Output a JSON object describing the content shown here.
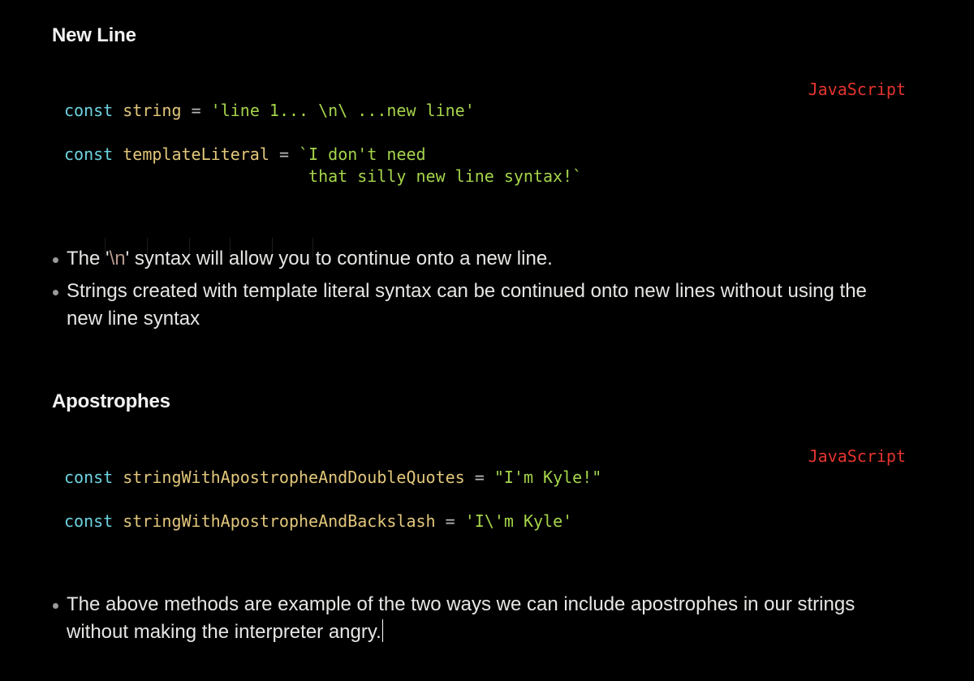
{
  "sections": [
    {
      "heading": "New Line",
      "language": "JavaScript",
      "code": {
        "line1": {
          "keyword": "const",
          "name": "string",
          "op": "=",
          "value": "'line 1... \\n\\ ...new line'"
        },
        "line2": {
          "keyword": "const",
          "name": "templateLiteral",
          "op": "=",
          "value_part1": "`I don't need",
          "value_part2": "that silly new line syntax!`"
        }
      },
      "bullets": {
        "b1_before": "The '",
        "b1_escape": "\\n",
        "b1_after": "' syntax will allow you to continue onto a new line.",
        "b2": "Strings created with template literal syntax can be continued onto new lines without using the new line syntax"
      }
    },
    {
      "heading": "Apostrophes",
      "language": "JavaScript",
      "code": {
        "line1": {
          "keyword": "const",
          "name": "stringWithApostropheAndDoubleQuotes",
          "op": "=",
          "value": "\"I'm Kyle!\""
        },
        "line2": {
          "keyword": "const",
          "name": "stringWithApostropheAndBackslash",
          "op": "=",
          "value": "'I\\'m Kyle'"
        }
      },
      "bullets": {
        "b1": "The above methods are example of the two ways we can include apostrophes in our strings without making the interpreter angry."
      }
    }
  ],
  "colors": {
    "background": "#000000",
    "keyword": "#6cd3e0",
    "identifier": "#e3c77b",
    "string": "#a5d44a",
    "language_label": "#e3342f"
  }
}
